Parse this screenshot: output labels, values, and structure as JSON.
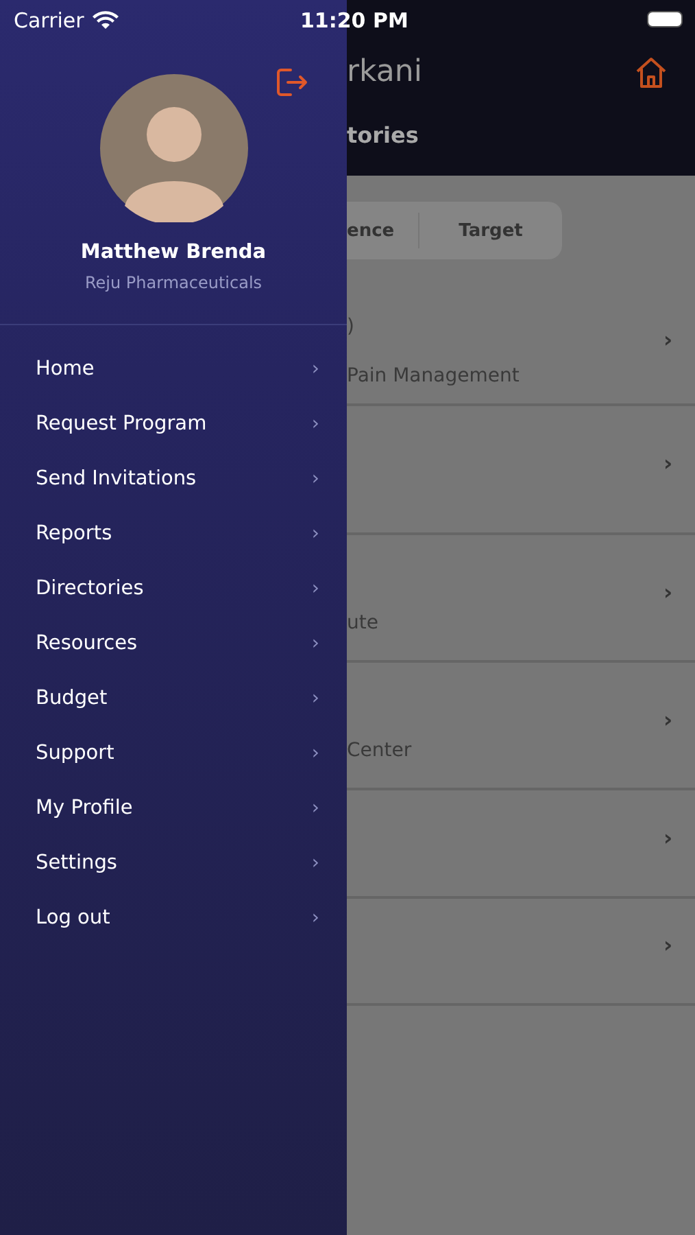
{
  "status_bar": {
    "carrier": "Carrier",
    "time": "11:20 PM"
  },
  "drawer": {
    "profile": {
      "name": "Matthew Brenda",
      "company": "Reju Pharmaceuticals"
    },
    "menu": [
      {
        "label": "Home",
        "chevron": "›"
      },
      {
        "label": "Request Program",
        "chevron": "›"
      },
      {
        "label": "Send Invitations",
        "chevron": "›"
      },
      {
        "label": "Reports",
        "chevron": "›"
      },
      {
        "label": "Directories",
        "chevron": "›"
      },
      {
        "label": "Resources",
        "chevron": "›"
      },
      {
        "label": "Budget",
        "chevron": "›"
      },
      {
        "label": "Support",
        "chevron": "›"
      },
      {
        "label": "My Profile",
        "chevron": "›"
      },
      {
        "label": "Settings",
        "chevron": "›"
      },
      {
        "label": "Log out",
        "chevron": "›"
      }
    ]
  },
  "background_screen": {
    "logo": "rkani",
    "title": "tories",
    "segments": [
      {
        "label": "ence"
      },
      {
        "label": "Target"
      }
    ],
    "rows": [
      {
        "line_1": ")",
        "line_2": "Pain Management",
        "chevron": "›"
      },
      {
        "chevron": "›"
      },
      {
        "line_2": "ute",
        "chevron": "›"
      },
      {
        "line_2": "Center",
        "chevron": "›"
      },
      {
        "chevron": "›"
      },
      {
        "chevron": "›"
      }
    ]
  }
}
